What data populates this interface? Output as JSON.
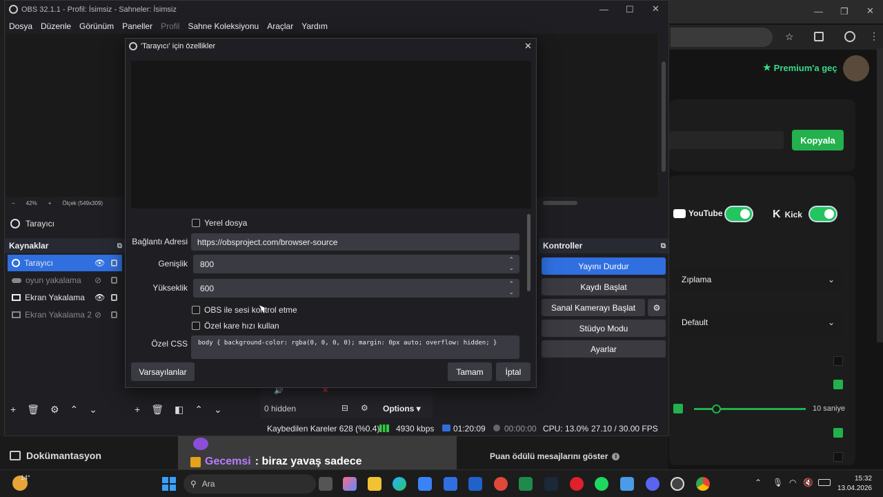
{
  "obs": {
    "title": "OBS 32.1.1 - Profil: İsimsiz - Sahneler: İsimsiz",
    "menu": [
      "Dosya",
      "Düzenle",
      "Görünüm",
      "Paneller",
      "Profil",
      "Sahne Koleksiyonu",
      "Araçlar",
      "Yardım"
    ],
    "preview_toolbar": {
      "zoom": "42%",
      "scale": "Ölçek (549x309)"
    },
    "selected_source": "Tarayıcı",
    "sources_title": "Kaynaklar",
    "sources": [
      {
        "name": "Tarayıcı",
        "visible": true,
        "selected": true
      },
      {
        "name": "oyun yakalama",
        "visible": false,
        "selected": false
      },
      {
        "name": "Ekran Yakalama",
        "visible": true,
        "selected": false
      },
      {
        "name": "Ekran Yakalama 2",
        "visible": false,
        "selected": false
      }
    ],
    "controls_title": "Kontroller",
    "controls": {
      "stop_stream": "Yayını Durdur",
      "start_record": "Kaydı Başlat",
      "start_vcam": "Sanal Kamerayı Başlat",
      "studio_mode": "Stüdyo Modu",
      "settings": "Ayarlar"
    },
    "mixer": {
      "hidden": "0 hidden",
      "options": "Options"
    },
    "status": {
      "dropped": "Kaybedilen Kareler 628 (%0.4)",
      "bitrate": "4930 kbps",
      "stream_time": "01:20:09",
      "record_time": "00:00:00",
      "cpu": "CPU: 13.0%",
      "fps": "27.10 / 30.00 FPS"
    }
  },
  "dialog": {
    "title": "'Tarayıcı' için özellikler",
    "local_file": "Yerel dosya",
    "url_label": "Bağlantı Adresi",
    "url_value": "https://obsproject.com/browser-source",
    "width_label": "Genişlik",
    "width_value": "800",
    "height_label": "Yükseklik",
    "height_value": "600",
    "control_audio": "OBS ile sesi kontrol etme",
    "custom_fps": "Özel kare hızı kullan",
    "css_label": "Özel CSS",
    "css_value": "body { background-color: rgba(0, 0, 0, 0); margin: 0px auto; overflow: hidden; }",
    "defaults": "Varsayılanlar",
    "ok": "Tamam",
    "cancel": "İptal"
  },
  "browser": {
    "premium": "Premium'a geç",
    "copy": "Kopyala",
    "youtube": "YouTube",
    "kick": "Kick",
    "dropdown1": "Zıplama",
    "dropdown2": "Default",
    "slider_label": "10 saniye",
    "slider_value": 0.2,
    "reward_label": "Puan ödülü mesajlarını göster"
  },
  "chat": {
    "docs": "Dokümantasyon",
    "user": "Gecemsi",
    "message": ": biraz yavaş sadece"
  },
  "taskbar": {
    "weather": "14°",
    "search": "Ara",
    "time": "15:32",
    "date": "13.04.2026"
  },
  "colors": {
    "accent": "#2f6fe0",
    "green": "#22b14c",
    "toggle": "#22c55e"
  }
}
